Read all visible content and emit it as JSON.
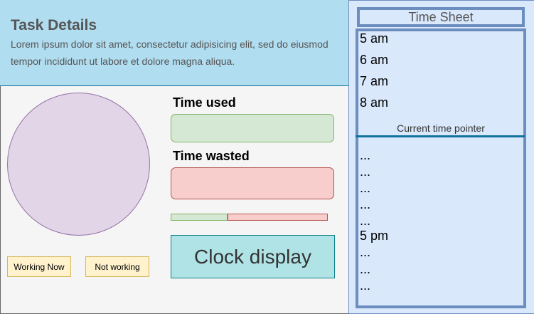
{
  "task": {
    "title": "Task Details",
    "description": "Lorem ipsum dolor sit amet, consectetur adipisicing elit, sed do eiusmod tempor incididunt ut labore et dolore magna aliqua."
  },
  "status_buttons": {
    "working_label": "Working Now",
    "not_working_label": "Not working"
  },
  "time_used": {
    "label": "Time used"
  },
  "time_wasted": {
    "label": "Time wasted"
  },
  "ratio": {
    "used_fraction": 0.36
  },
  "clock": {
    "label": "Clock display"
  },
  "timesheet": {
    "title": "Time Sheet",
    "pointer_label": "Current time pointer",
    "slots": [
      "5 am",
      "6 am",
      "7 am",
      "8 am",
      "...",
      "...",
      "...",
      "...",
      "...",
      "5 pm",
      "...",
      "...",
      "..."
    ]
  },
  "colors": {
    "header_bg": "#b1ddf0",
    "used": "#d5e8d4",
    "wasted": "#f8cecc",
    "clock": "#b0e3e6",
    "circle": "#e1d5e7",
    "timesheet_bg": "#dae8fc",
    "pointer": "#10739e"
  }
}
